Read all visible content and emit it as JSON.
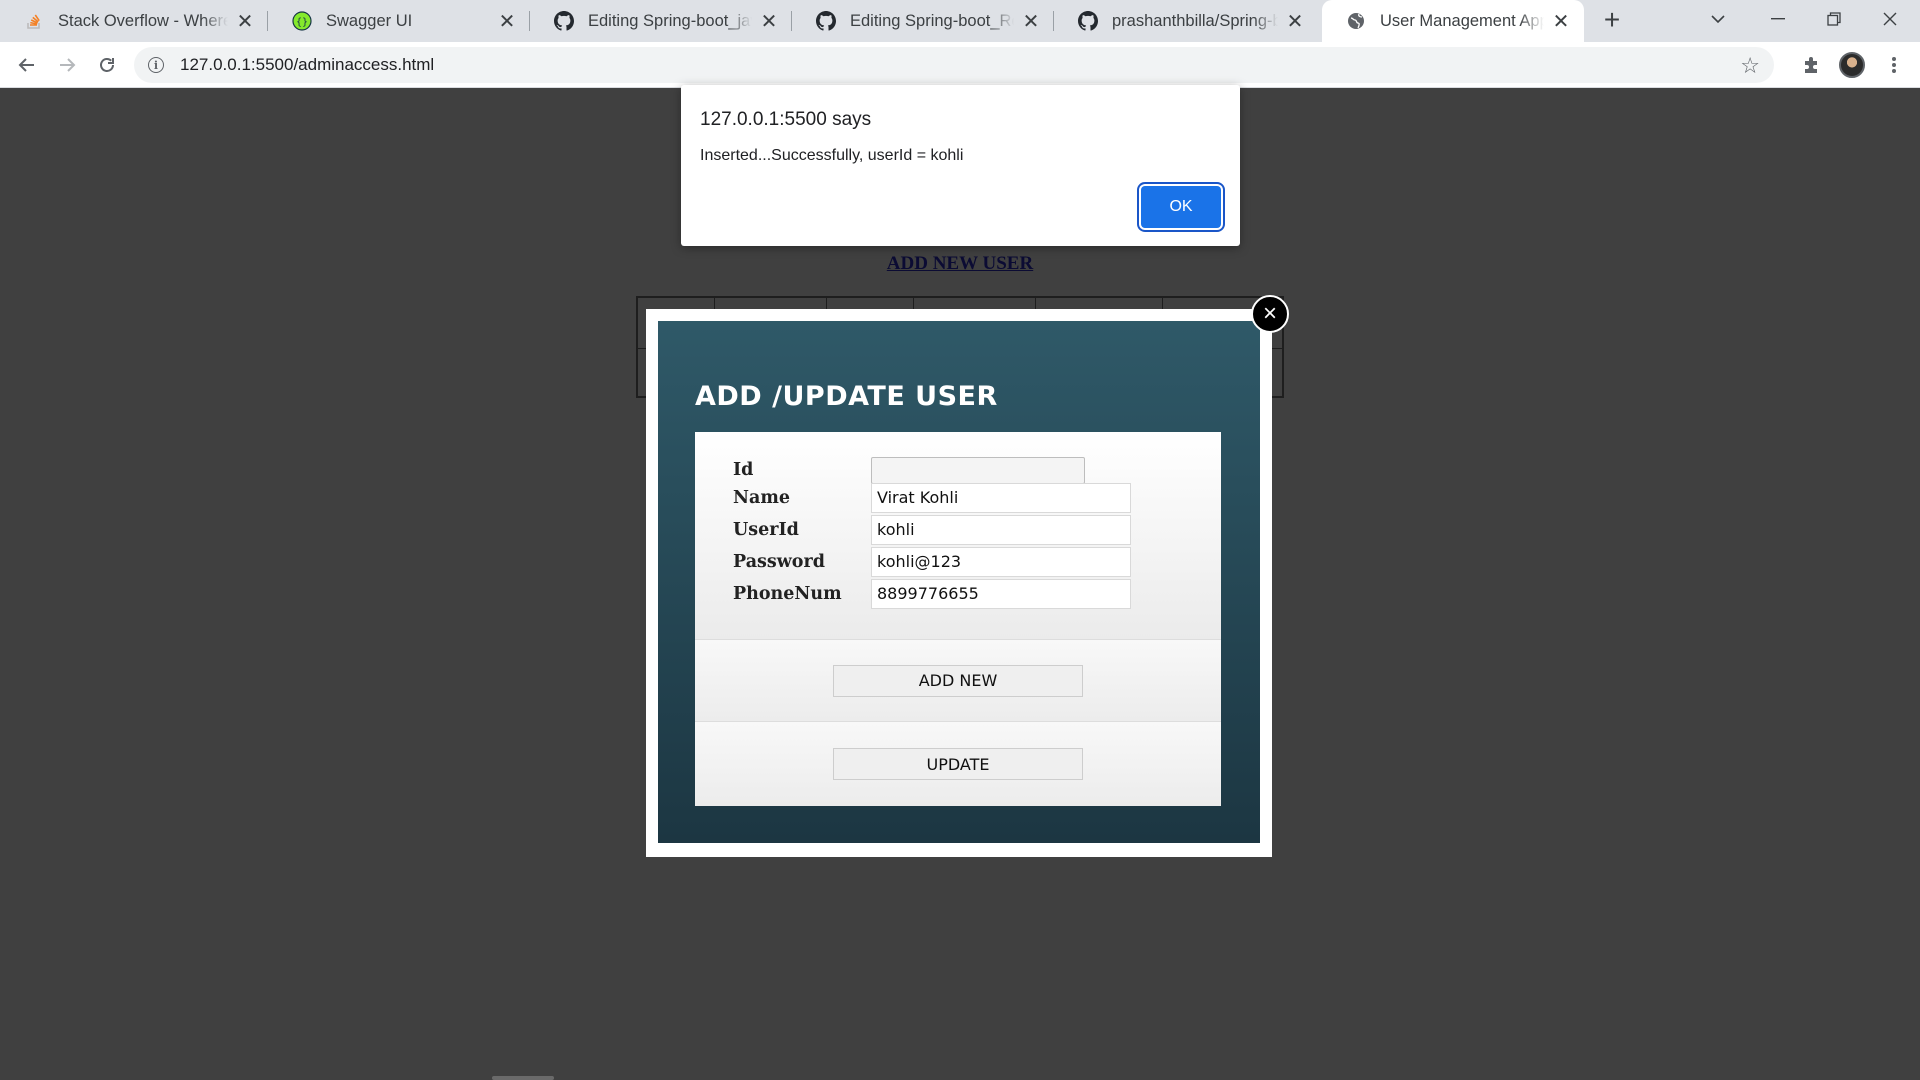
{
  "browser": {
    "tabs": [
      {
        "title": "Stack Overflow - Where Developers Learn",
        "icon": "stackoverflow-icon"
      },
      {
        "title": "Swagger UI",
        "icon": "swagger-icon"
      },
      {
        "title": "Editing Spring-boot_javascript",
        "icon": "github-icon"
      },
      {
        "title": "Editing Spring-boot_ReactJs",
        "icon": "github-icon"
      },
      {
        "title": "prashanthbilla/Spring-boot",
        "icon": "github-icon"
      },
      {
        "title": "User Management App",
        "icon": "globe-icon"
      }
    ],
    "active_tab": 5,
    "url": "127.0.0.1:5500/adminaccess.html"
  },
  "page": {
    "add_new_user_link": "ADD NEW USER"
  },
  "modal": {
    "title": "ADD /UPDATE USER",
    "close_symbol": "×",
    "fields": [
      {
        "label": "Id",
        "value": ""
      },
      {
        "label": "Name",
        "value": "Virat Kohli"
      },
      {
        "label": "UserId",
        "value": "kohli"
      },
      {
        "label": "Password",
        "value": "kohli@123"
      },
      {
        "label": "PhoneNum",
        "value": "8899776655"
      }
    ],
    "add_button": "ADD NEW",
    "update_button": "UPDATE"
  },
  "alert": {
    "origin": "127.0.0.1:5500 says",
    "message": "Inserted...Successfully, userId = kohli",
    "ok_label": "OK",
    "ok_color": "#1a73e8"
  }
}
